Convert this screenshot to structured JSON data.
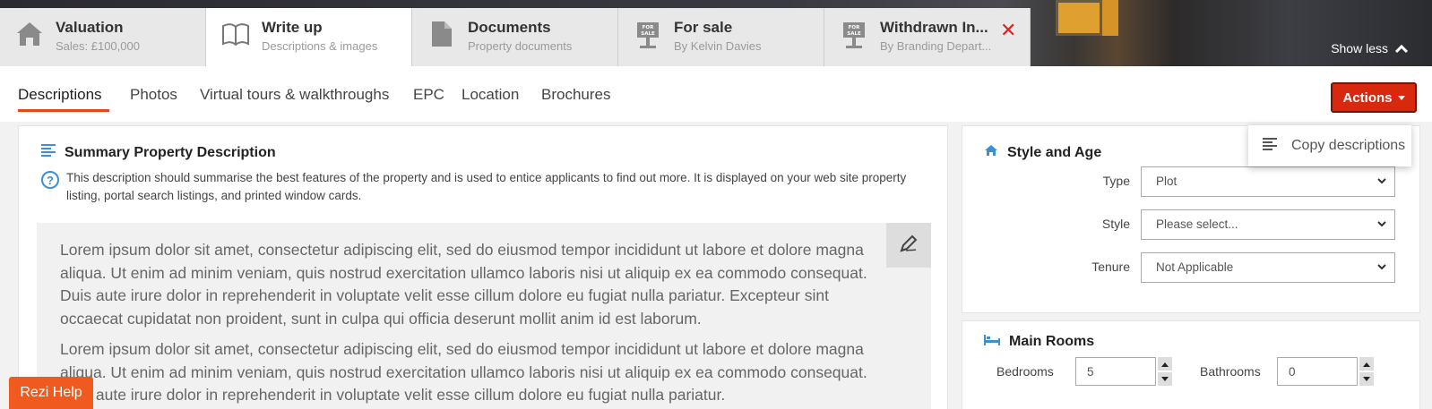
{
  "header": {
    "tabs": [
      {
        "title": "Valuation",
        "subtitle": "Sales: £100,000",
        "icon": "house-icon"
      },
      {
        "title": "Write up",
        "subtitle": "Descriptions & images",
        "icon": "book-icon"
      },
      {
        "title": "Documents",
        "subtitle": "Property documents",
        "icon": "document-icon"
      },
      {
        "title": "For sale",
        "subtitle": "By Kelvin Davies",
        "icon": "for-sale-sign-icon"
      },
      {
        "title": "Withdrawn In...",
        "subtitle": "By Branding Depart...",
        "icon": "for-sale-sign-icon"
      }
    ],
    "close_symbol": "✕",
    "show_less": "Show less",
    "sign_text": "FOR SALE"
  },
  "subnav": {
    "items": [
      "Descriptions",
      "Photos",
      "Virtual tours & walkthroughs",
      "EPC",
      "Location",
      "Brochures"
    ],
    "actions_label": "Actions"
  },
  "dropdown": {
    "copy_descriptions": "Copy descriptions"
  },
  "summary": {
    "title": "Summary Property Description",
    "help_icon": "?",
    "help_text": "This description should summarise the best features of the property and is used to entice applicants to find out more. It is displayed on your web site property listing, portal search listings, and printed window cards.",
    "paragraphs": [
      "Lorem ipsum dolor sit amet, consectetur adipiscing elit, sed do eiusmod tempor incididunt ut labore et dolore magna aliqua. Ut enim ad minim veniam, quis nostrud exercitation ullamco laboris nisi ut aliquip ex ea commodo consequat. Duis aute irure dolor in reprehenderit in voluptate velit esse cillum dolore eu fugiat nulla pariatur. Excepteur sint occaecat cupidatat non proident, sunt in culpa qui officia deserunt mollit anim id est laborum.",
      "Lorem ipsum dolor sit amet, consectetur adipiscing elit, sed do eiusmod tempor incididunt ut labore et dolore magna aliqua. Ut enim ad minim veniam, quis nostrud exercitation ullamco laboris nisi ut aliquip ex ea commodo consequat. Duis aute irure dolor in reprehenderit in voluptate velit esse cillum dolore eu fugiat nulla pariatur."
    ]
  },
  "style_age": {
    "title": "Style and Age",
    "type_label": "Type",
    "type_value": "Plot",
    "style_label": "Style",
    "style_value": "Please select...",
    "tenure_label": "Tenure",
    "tenure_value": "Not Applicable"
  },
  "main_rooms": {
    "title": "Main Rooms",
    "bedrooms_label": "Bedrooms",
    "bedrooms_value": "5",
    "bathrooms_label": "Bathrooms",
    "bathrooms_value": "0"
  },
  "help_button": "Rezi Help",
  "colors": {
    "accent": "#d8290f",
    "help_button": "#f05a1e",
    "underline": "#e24b12",
    "info_blue": "#3d8fd4"
  }
}
